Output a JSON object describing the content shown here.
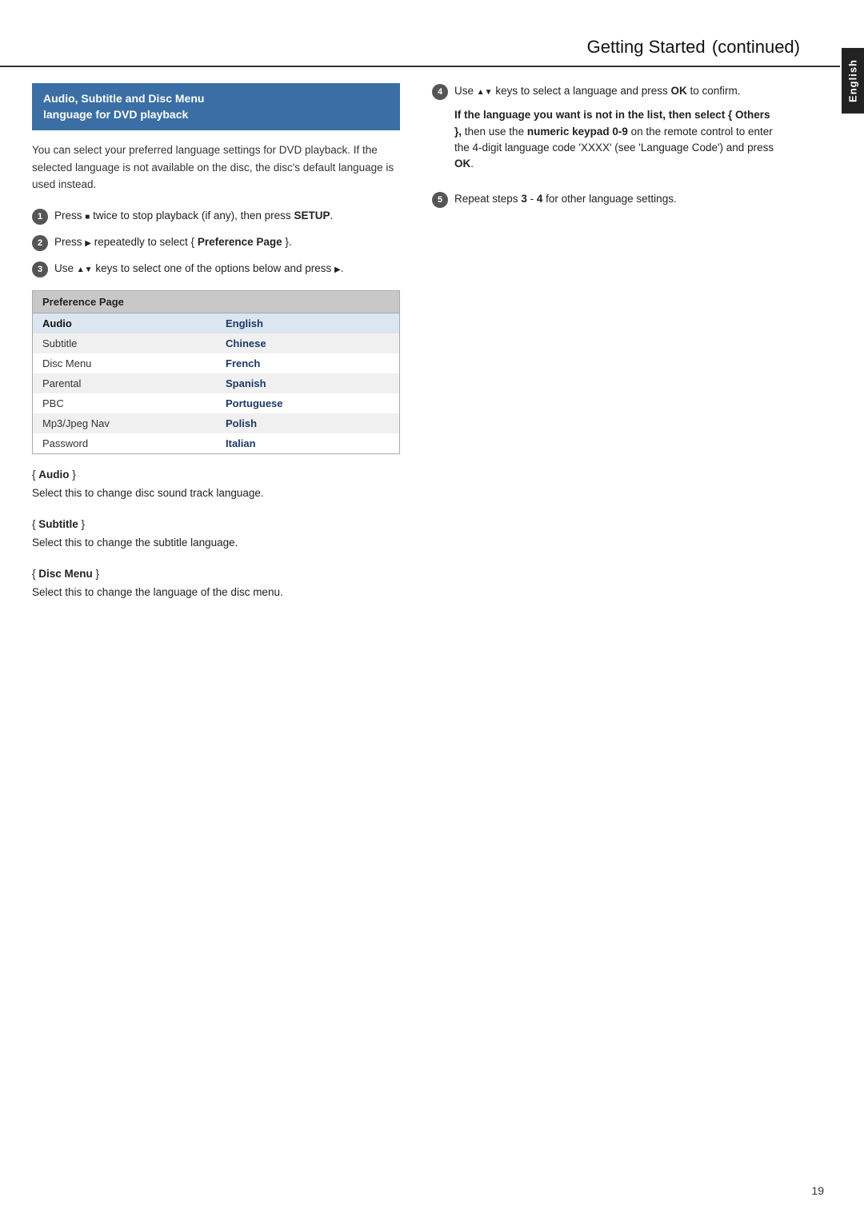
{
  "header": {
    "title": "Getting Started",
    "subtitle": "continued"
  },
  "side_tab": {
    "label": "English"
  },
  "blue_box": {
    "line1": "Audio, Subtitle and Disc Menu",
    "line2": "language for DVD playback"
  },
  "intro": "You can select your preferred language settings for DVD playback. If the selected language is not available on the disc, the disc's default language is used instead.",
  "steps_left": [
    {
      "num": "1",
      "html": "Press <span class='stop-square'></span> twice to stop playback (if any), then press <b>SETUP</b>."
    },
    {
      "num": "2",
      "html": "Press <span class='tri-right'></span> repeatedly to select { <b>Preference Page</b> }."
    },
    {
      "num": "3",
      "html": "Use <span class='tri-up'></span><span class='tri-down'></span> keys to select one of the options below and press <span class='tri-right'></span>."
    }
  ],
  "pref_table": {
    "header": "Preference Page",
    "rows": [
      {
        "left": "Audio",
        "right": "English",
        "style": "highlighted"
      },
      {
        "left": "Subtitle",
        "right": "Chinese",
        "style": "alt"
      },
      {
        "left": "Disc Menu",
        "right": "French",
        "style": "normal"
      },
      {
        "left": "Parental",
        "right": "Spanish",
        "style": "alt"
      },
      {
        "left": "PBC",
        "right": "Portuguese",
        "style": "normal"
      },
      {
        "left": "Mp3/Jpeg Nav",
        "right": "Polish",
        "style": "alt"
      },
      {
        "left": "Password",
        "right": "Italian",
        "style": "normal"
      }
    ]
  },
  "sections": [
    {
      "id": "audio",
      "title": "{ Audio }",
      "desc": "Select this to change disc sound track language."
    },
    {
      "id": "subtitle",
      "title": "{ Subtitle }",
      "desc": "Select this to change the subtitle language."
    },
    {
      "id": "disc-menu",
      "title": "{ Disc Menu }",
      "desc": "Select this to change the language of the disc menu."
    }
  ],
  "steps_right": [
    {
      "num": "4",
      "html": "Use <span class='tri-up'></span><span class='tri-down'></span> keys to select a language and press <b>OK</b> to confirm."
    },
    {
      "num": "5",
      "html": "Repeat steps <b>3</b> - <b>4</b> for other language settings."
    }
  ],
  "right_bold_text": "If the language you want is not in the list, then select { Others }, then use the numeric keypad 0-9 on the remote control to enter the 4-digit language code 'XXXX' (see 'Language Code') and press OK.",
  "page_number": "19"
}
